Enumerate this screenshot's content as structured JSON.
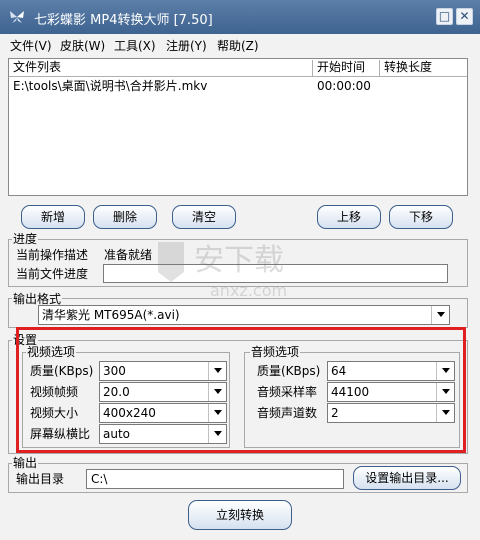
{
  "window": {
    "title": "七彩蝶影 MP4转换大师 [7.50]",
    "minimize_glyph": "□",
    "close_glyph": "✕"
  },
  "menu": [
    "文件(V)",
    "皮肤(W)",
    "工具(X)",
    "注册(Y)",
    "帮助(Z)"
  ],
  "file_list": {
    "columns": [
      "文件列表",
      "开始时间",
      "转换长度"
    ],
    "rows": [
      {
        "file": "E:\\tools\\桌面\\说明书\\合并影片.mkv",
        "start": "00:00:00",
        "length": ""
      }
    ]
  },
  "actions": {
    "add": "新增",
    "delete": "删除",
    "clear": "清空",
    "move_up": "上移",
    "move_down": "下移"
  },
  "progress": {
    "group_label": "进度",
    "op_label": "当前操作描述",
    "op_value": "准备就绪",
    "file_label": "当前文件进度",
    "file_progress": 0
  },
  "output_format": {
    "group_label": "输出格式",
    "selected": "清华紫光 MT695A(*.avi)"
  },
  "settings": {
    "group_label": "设置",
    "video": {
      "group_label": "视频选项",
      "quality_label": "质量(KBps)",
      "quality": "300",
      "framerate_label": "视频帧频",
      "framerate": "20.0",
      "size_label": "视频大小",
      "size": "400x240",
      "aspect_label": "屏幕纵横比",
      "aspect": "auto"
    },
    "audio": {
      "group_label": "音频选项",
      "quality_label": "质量(KBps)",
      "quality": "64",
      "samplerate_label": "音频采样率",
      "samplerate": "44100",
      "channels_label": "音频声道数",
      "channels": "2"
    }
  },
  "output": {
    "group_label": "输出",
    "dir_label": "输出目录",
    "dir_value": "C:\\",
    "set_dir_button": "设置输出目录..."
  },
  "convert_button": "立刻转换",
  "watermark": {
    "text": "安下载",
    "url": "anxz.com"
  },
  "colors": {
    "titlebar": "#4a6f9c",
    "highlight": "#e02020",
    "button_border": "#3d5f8c"
  }
}
